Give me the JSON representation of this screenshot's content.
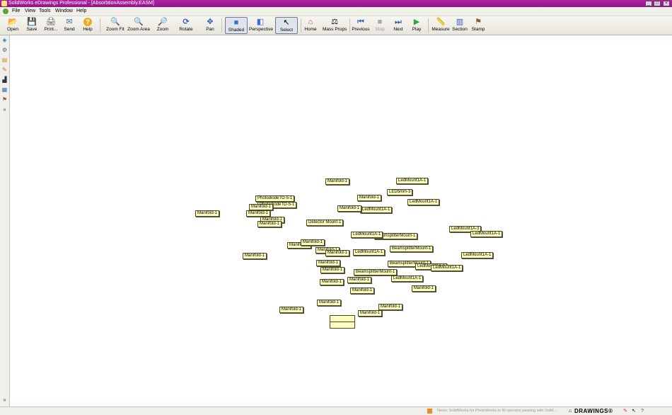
{
  "window": {
    "title": "SolidWorks eDrawings Professional - [AbsorbtionAssembly.EASM]",
    "controls": [
      "_",
      "□",
      "×"
    ]
  },
  "menu": [
    "File",
    "View",
    "Tools",
    "Window",
    "Help"
  ],
  "toolbar": [
    {
      "label": "Open",
      "icon": "folder-open-icon",
      "glyph": "📂"
    },
    {
      "label": "Save",
      "icon": "save-icon",
      "glyph": "💾"
    },
    {
      "label": "Print...",
      "icon": "print-icon",
      "glyph": "🖨"
    },
    {
      "label": "Send",
      "icon": "send-icon",
      "glyph": "✉"
    },
    {
      "label": "Help",
      "icon": "help-icon",
      "glyph": "?"
    },
    {
      "label": "Zoom Fit",
      "icon": "zoom-fit-icon",
      "glyph": "🔍"
    },
    {
      "label": "Zoom Area",
      "icon": "zoom-area-icon",
      "glyph": "🔍"
    },
    {
      "label": "Zoom",
      "icon": "zoom-icon",
      "glyph": "🔎"
    },
    {
      "label": "Rotate",
      "icon": "rotate-icon",
      "glyph": "⟳"
    },
    {
      "label": "Pan",
      "icon": "pan-icon",
      "glyph": "✥"
    },
    {
      "label": "Shaded",
      "icon": "shaded-icon",
      "glyph": "■"
    },
    {
      "label": "Perspective",
      "icon": "perspective-icon",
      "glyph": "◧"
    },
    {
      "label": "Select",
      "icon": "select-icon",
      "glyph": "↖"
    },
    {
      "label": "Home",
      "icon": "home-icon",
      "glyph": "⌂"
    },
    {
      "label": "Mass Props",
      "icon": "mass-props-icon",
      "glyph": "⚖"
    },
    {
      "label": "Previous",
      "icon": "previous-icon",
      "glyph": "⏮"
    },
    {
      "label": "Stop",
      "icon": "stop-icon",
      "glyph": "■"
    },
    {
      "label": "Next",
      "icon": "next-icon",
      "glyph": "⏭"
    },
    {
      "label": "Play",
      "icon": "play-icon",
      "glyph": "▶"
    },
    {
      "label": "Measure",
      "icon": "measure-icon",
      "glyph": "📏"
    },
    {
      "label": "Section",
      "icon": "section-icon",
      "glyph": "▥"
    },
    {
      "label": "Stamp",
      "icon": "stamp-icon",
      "glyph": "⚑"
    }
  ],
  "sidebar_icons": [
    "components-icon",
    "configurations-icon",
    "sheets-icon",
    "markup-icon",
    "measure-tool-icon",
    "mass-icon",
    "stamp-tool-icon",
    "expand-icon"
  ],
  "callouts": [
    "Manifold-1",
    "LedMount1A-1",
    "LED5mm-3",
    "Manifold-1",
    "PhotodiodeTO-5-1",
    "PhotodiodeTO-5-1",
    "Manifold-1",
    "Manifold-1",
    "Manifold-1",
    "Manifold-1",
    "Manifold-1",
    "LedMount1A-1",
    "Manifold-1",
    "LedMount1A-1",
    "Detector Mount-1",
    "LedMount1A-3",
    "LedMount1A-1",
    "BeamsplitterMount-1",
    "LedMount1A-1",
    "BeamsplitterMount-1",
    "Manifold-1",
    "Manifold-1",
    "Manifold-1",
    "LedMount1A-1",
    "Manifold-1",
    "Manifold-1",
    "BeamsplitterMount-1",
    "LedMount1A-1",
    "Manifold-1",
    "BeamsplitterMount-1",
    "Manifold-1",
    "Manifold-1",
    "LedMount1A-1",
    "Manifold-1",
    "LedMount1A-1",
    "Manifold-1",
    "Manifold-1",
    "Manifold-1",
    "Manifold-1",
    "Manifold-1",
    "Manifold-1",
    "LedMount1A-1"
  ],
  "status": {
    "text": "News: SolidWorks for PhotoWorks to fill operator passing with Solid...",
    "brand": "DRAWINGS®"
  }
}
